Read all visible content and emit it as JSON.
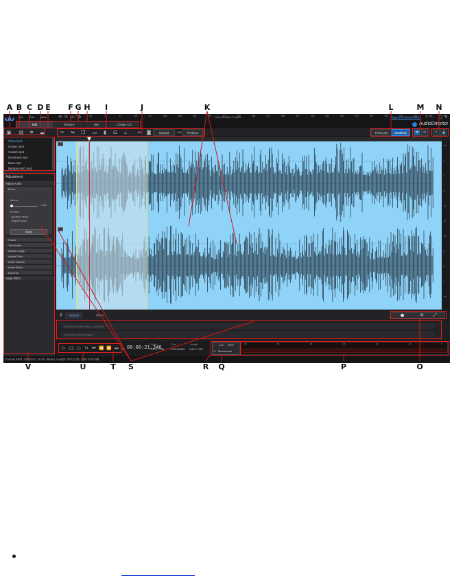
{
  "callouts": {
    "top": [
      "A",
      "B",
      "C",
      "D",
      "E",
      "F",
      "G",
      "H",
      "I",
      "J",
      "K",
      "L",
      "M",
      "N"
    ],
    "bottom": [
      "V",
      "U",
      "T",
      "S",
      "R",
      "Q",
      "P",
      "O"
    ]
  },
  "app": {
    "menu": [
      "File",
      "Edit",
      "View"
    ],
    "project_title": "*New Untitled Project",
    "sign_in": "Sign in to DirectorZone",
    "window_controls": [
      "?",
      "–",
      "□",
      "✕"
    ],
    "brand": "AudioDirector",
    "mode_tabs": [
      "Edit",
      "Restore",
      "Mix",
      "Create CD"
    ],
    "active_mode": "Edit",
    "toolbar": {
      "upload_label": "Upload",
      "produce_label": "Produce",
      "timecode_btn": "Timecode",
      "bar_beat_btn": "Bar/Beat"
    },
    "library": [
      {
        "name": "Piano.mp3",
        "active": true
      },
      {
        "name": "Guitar1.mp3",
        "active": false
      },
      {
        "name": "Guitar2.mp3",
        "active": false
      },
      {
        "name": "Drumtrack.mp3",
        "active": false
      },
      {
        "name": "Bass.mp3",
        "active": false
      },
      {
        "name": "BackgroundG.mp3",
        "active": false
      }
    ],
    "adjustment": {
      "header": "Adjustment",
      "section": "Adjust Audio",
      "boost_label": "Boost",
      "volume_label": "Volume",
      "volume_value": "0 dB",
      "preview_label": "Preview",
      "preview_options": [
        "Adjusted result",
        "Original audio"
      ],
      "apply_label": "Apply",
      "items": [
        "Fades",
        "Trim Audio",
        "Adjust Length",
        "Adjust Pitch",
        "Insert Silence",
        "Insert Noise",
        "Reverse"
      ],
      "apply_effect": "Apply Effect"
    },
    "ruler_ticks": [
      "37",
      "55",
      "73",
      "91",
      "109",
      "127",
      "145",
      "163",
      "181",
      "199",
      "217",
      "235",
      "253",
      "271",
      "289",
      "307",
      "325",
      "343",
      "361",
      "379",
      "397",
      "415",
      "433",
      "451",
      "469",
      "487"
    ],
    "vscale_ticks": [
      "-dB",
      "-1",
      "-3",
      "-6",
      "-12",
      "-inf",
      "-12",
      "-6",
      "-3",
      "-1",
      "-dB"
    ],
    "volume_tabs": [
      "Volume",
      "Effect"
    ],
    "effect_rows": [
      "Adjust the volume using a curved line",
      "Use mouse wheel to adjust"
    ],
    "transport": {
      "timecode": "00:00:21.346",
      "start_label": "Start",
      "start_value": "0:00:17.796",
      "end_label": "End",
      "end_value": "0:00:26.853",
      "length_label": "Length",
      "length_value": "0:00:17.057",
      "bpm_value": "120",
      "bpm_label": "BPM",
      "metronome_label": "Metronome"
    },
    "meter_scale": [
      "-dB",
      "-60",
      "-48",
      "-36",
      "-24",
      "-12",
      "0"
    ],
    "status": "Format: MP3, 44100 Hz, 16-bit, Stereo, Length: 04:12.431, Size: 5.97 MB"
  }
}
